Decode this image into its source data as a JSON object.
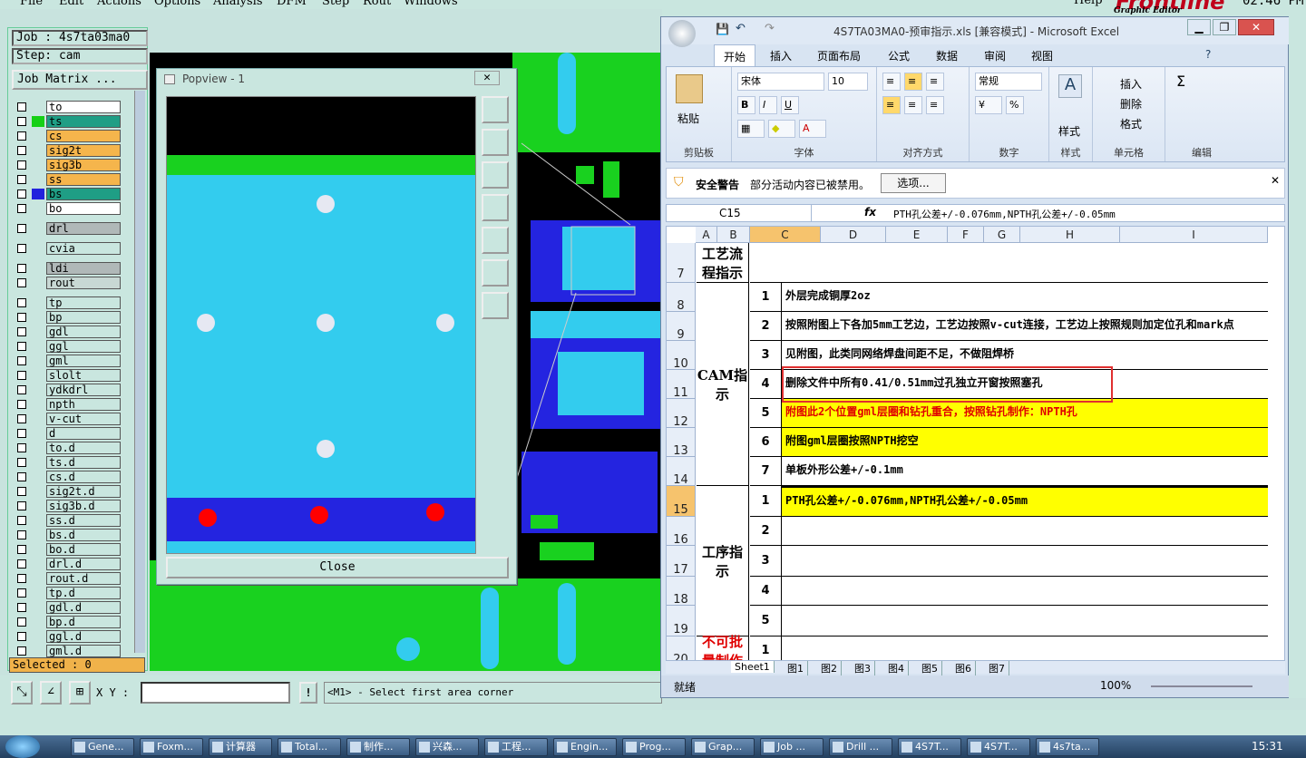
{
  "menu": [
    "File",
    "Edit",
    "Actions",
    "Options",
    "Analysis",
    "DFM",
    "Step",
    "Rout",
    "Windows"
  ],
  "topright": {
    "help": "Help",
    "brand": "Frontline",
    "subtitle": "Graphic Editor",
    "clock": "02:46 PM"
  },
  "job": {
    "job_label": "Job : 4s7ta03ma0",
    "step_label": "Step: cam",
    "matrix_button": "Job Matrix ..."
  },
  "layers": [
    {
      "name": "to",
      "color": "#ffffff",
      "swatch": ""
    },
    {
      "name": "ts",
      "color": "#1f9e85",
      "swatch": "#16d016"
    },
    {
      "name": "cs",
      "color": "#f5b54c",
      "swatch": ""
    },
    {
      "name": "sig2t",
      "color": "#f5b54c",
      "swatch": ""
    },
    {
      "name": "sig3b",
      "color": "#f5b54c",
      "swatch": ""
    },
    {
      "name": "ss",
      "color": "#f5b54c",
      "swatch": ""
    },
    {
      "name": "bs",
      "color": "#1f9e85",
      "swatch": "#2222dd"
    },
    {
      "name": "bo",
      "color": "#ffffff",
      "swatch": ""
    },
    {
      "name": "drl",
      "color": "#b0b8b8",
      "swatch": ""
    },
    {
      "name": "cvia",
      "color": "#c9e6df",
      "swatch": ""
    },
    {
      "name": "ldi",
      "color": "#b0b8b8",
      "swatch": ""
    },
    {
      "name": "rout",
      "color": "#c8d8d4",
      "swatch": ""
    },
    {
      "name": "tp",
      "color": "#c9e6df",
      "swatch": ""
    },
    {
      "name": "bp",
      "color": "#c9e6df",
      "swatch": ""
    },
    {
      "name": "gdl",
      "color": "#c9e6df",
      "swatch": ""
    },
    {
      "name": "ggl",
      "color": "#c9e6df",
      "swatch": ""
    },
    {
      "name": "gml",
      "color": "#c9e6df",
      "swatch": ""
    },
    {
      "name": "slolt",
      "color": "#c9e6df",
      "swatch": ""
    },
    {
      "name": "ydkdrl",
      "color": "#c9e6df",
      "swatch": ""
    },
    {
      "name": "npth",
      "color": "#c9e6df",
      "swatch": ""
    },
    {
      "name": "v-cut",
      "color": "#c9e6df",
      "swatch": ""
    },
    {
      "name": "d",
      "color": "#c9e6df",
      "swatch": ""
    },
    {
      "name": "to.d",
      "color": "#c9e6df",
      "swatch": ""
    },
    {
      "name": "ts.d",
      "color": "#c9e6df",
      "swatch": ""
    },
    {
      "name": "cs.d",
      "color": "#c9e6df",
      "swatch": ""
    },
    {
      "name": "sig2t.d",
      "color": "#c9e6df",
      "swatch": ""
    },
    {
      "name": "sig3b.d",
      "color": "#c9e6df",
      "swatch": ""
    },
    {
      "name": "ss.d",
      "color": "#c9e6df",
      "swatch": ""
    },
    {
      "name": "bs.d",
      "color": "#c9e6df",
      "swatch": ""
    },
    {
      "name": "bo.d",
      "color": "#c9e6df",
      "swatch": ""
    },
    {
      "name": "drl.d",
      "color": "#c9e6df",
      "swatch": ""
    },
    {
      "name": "rout.d",
      "color": "#c9e6df",
      "swatch": ""
    },
    {
      "name": "tp.d",
      "color": "#c9e6df",
      "swatch": ""
    },
    {
      "name": "gdl.d",
      "color": "#c9e6df",
      "swatch": ""
    },
    {
      "name": "bp.d",
      "color": "#c9e6df",
      "swatch": ""
    },
    {
      "name": "ggl.d",
      "color": "#c9e6df",
      "swatch": ""
    },
    {
      "name": "gml.d",
      "color": "#c9e6df",
      "swatch": ""
    }
  ],
  "selected": "Selected : 0",
  "bottom": {
    "xy_label": "X Y :",
    "xy_value": "",
    "bang": "!",
    "message": "<M1> - Select first area corner"
  },
  "popview": {
    "title": "Popview - 1",
    "close_label": "Close"
  },
  "excel": {
    "title": "4S7TA03MA0-预审指示.xls [兼容模式] - Microsoft Excel",
    "tabs": [
      "开始",
      "插入",
      "页面布局",
      "公式",
      "数据",
      "审阅",
      "视图"
    ],
    "font_name": "宋体",
    "font_size": "10",
    "number_format": "常规",
    "groups": [
      "剪贴板",
      "字体",
      "对齐方式",
      "数字",
      "样式",
      "单元格",
      "编辑"
    ],
    "paste": "粘贴",
    "style": "样式",
    "insert": "插入",
    "delete": "删除",
    "format": "格式",
    "security_title": "安全警告",
    "security_msg": "部分活动内容已被禁用。",
    "options_button": "选项...",
    "name_box": "C15",
    "formula": "PTH孔公差+/-0.076mm,NPTH孔公差+/-0.05mm",
    "columns": [
      "A",
      "B",
      "C",
      "D",
      "E",
      "F",
      "G",
      "H",
      "I"
    ],
    "rows": [
      {
        "row": "7",
        "num": "",
        "text": ""
      },
      {
        "row": "8",
        "num": "1",
        "text": "外层完成铜厚2oz"
      },
      {
        "row": "9",
        "num": "2",
        "text": "按照附图上下各加5mm工艺边，工艺边按照v-cut连接，工艺边上按照规则加定位孔和mark点"
      },
      {
        "row": "10",
        "num": "3",
        "text": "见附图，此类同网络焊盘间距不足，不做阻焊桥"
      },
      {
        "row": "11",
        "num": "4",
        "text": "删除文件中所有0.41/0.51mm过孔独立开窗按照塞孔"
      },
      {
        "row": "12",
        "num": "5",
        "text": "附图此2个位置gml层圈和钻孔重合，按照钻孔制作：NPTH孔"
      },
      {
        "row": "13",
        "num": "6",
        "text": "附图gml层圈按照NPTH挖空"
      },
      {
        "row": "14",
        "num": "7",
        "text": "单板外形公差+/-0.1mm"
      },
      {
        "row": "15",
        "num": "1",
        "text": "PTH孔公差+/-0.076mm,NPTH孔公差+/-0.05mm"
      },
      {
        "row": "16",
        "num": "2",
        "text": ""
      },
      {
        "row": "17",
        "num": "3",
        "text": ""
      },
      {
        "row": "18",
        "num": "4",
        "text": ""
      },
      {
        "row": "19",
        "num": "5",
        "text": ""
      },
      {
        "row": "20",
        "num": "1",
        "text": ""
      }
    ],
    "label_process": "工艺流程指示",
    "label_cam": "CAM指示",
    "label_step": "工序指示",
    "label_noapprove": "不可批量制作",
    "sheets": [
      "Sheet1",
      "图1",
      "图2",
      "图3",
      "图4",
      "图5",
      "图6",
      "图7"
    ],
    "status": "就绪",
    "zoom": "100%"
  },
  "taskbar": [
    "Gene...",
    "Foxm...",
    "计算器",
    "Total...",
    "制作...",
    "兴森...",
    "工程...",
    "Engin...",
    "Prog...",
    "Grap...",
    "Job ...",
    "Drill ...",
    "4S7T...",
    "4S7T...",
    "4s7ta..."
  ],
  "clock": "15:31",
  "colors": {
    "pcb_green": "#19d11f",
    "pcb_cyan": "#33ccee",
    "pcb_blue": "#2424e0",
    "highlight_yellow": "#ffff00",
    "red": "#ff0000"
  }
}
